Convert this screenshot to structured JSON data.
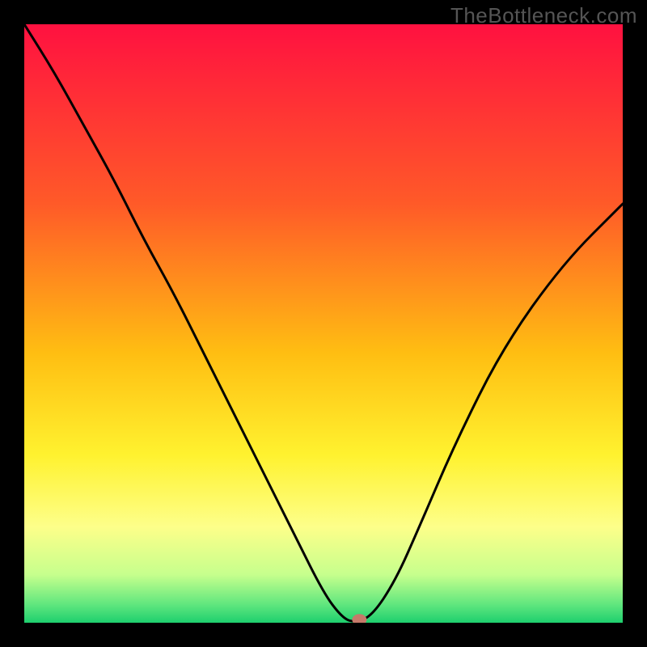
{
  "watermark": "TheBottleneck.com",
  "chart_data": {
    "type": "line",
    "title": "",
    "xlabel": "",
    "ylabel": "",
    "xlim": [
      0,
      1
    ],
    "ylim": [
      0,
      1
    ],
    "background": {
      "type": "vertical-gradient",
      "stops": [
        {
          "offset": 0.0,
          "color": "#ff1140"
        },
        {
          "offset": 0.3,
          "color": "#ff5a28"
        },
        {
          "offset": 0.55,
          "color": "#ffbe12"
        },
        {
          "offset": 0.72,
          "color": "#fff22f"
        },
        {
          "offset": 0.84,
          "color": "#fdff8a"
        },
        {
          "offset": 0.92,
          "color": "#c6ff8d"
        },
        {
          "offset": 0.97,
          "color": "#5fe67e"
        },
        {
          "offset": 1.0,
          "color": "#1ecf6e"
        }
      ]
    },
    "series": [
      {
        "name": "bottleneck-curve",
        "color": "#000000",
        "x": [
          0.0,
          0.05,
          0.1,
          0.15,
          0.2,
          0.25,
          0.3,
          0.35,
          0.4,
          0.45,
          0.5,
          0.53,
          0.55,
          0.58,
          0.62,
          0.66,
          0.72,
          0.8,
          0.9,
          1.0
        ],
        "y": [
          1.0,
          0.92,
          0.83,
          0.74,
          0.64,
          0.55,
          0.45,
          0.35,
          0.25,
          0.15,
          0.05,
          0.01,
          0.0,
          0.01,
          0.07,
          0.16,
          0.3,
          0.46,
          0.6,
          0.7
        ]
      }
    ],
    "marker": {
      "x": 0.56,
      "y": 0.005,
      "color": "#c67a6a",
      "label": "optimal-point"
    }
  }
}
